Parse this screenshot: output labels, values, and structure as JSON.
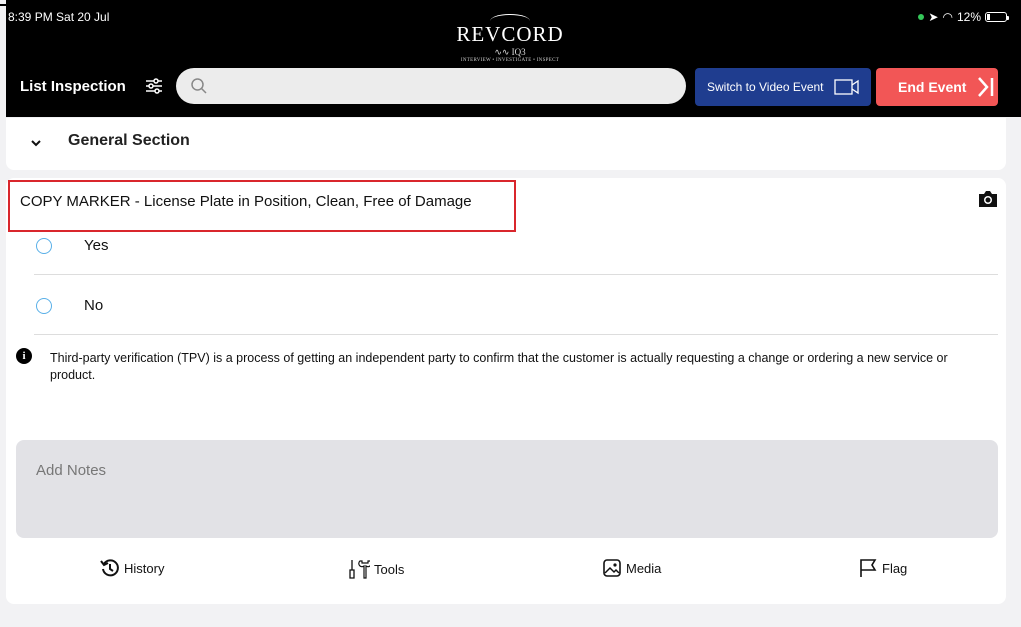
{
  "status_bar": {
    "time": "8:39 PM  Sat 20 Jul",
    "battery": "12%"
  },
  "logo": {
    "text": "REVCORD",
    "sub": "IQ3",
    "tagline": "INTERVIEW • INVESTIGATE • INSPECT"
  },
  "header": {
    "title": "List Inspection",
    "search_placeholder": "",
    "switch_video_label": "Switch to Video Event",
    "end_event_label": "End Event"
  },
  "section": {
    "title": "General Section"
  },
  "question": {
    "text": "COPY MARKER - License Plate in Position, Clean, Free of Damage",
    "options": [
      "Yes",
      "No"
    ],
    "info": "Third-party verification (TPV) is a process of getting an independent party to confirm that the customer is actually requesting a change or ordering a new service or product.",
    "notes_placeholder": "Add Notes"
  },
  "actions": {
    "history": "History",
    "tools": "Tools",
    "media": "Media",
    "flag": "Flag"
  },
  "colors": {
    "video_button": "#1f3d8f",
    "end_button": "#f25656",
    "highlight": "#d9262c",
    "radio": "#5ab0e8"
  }
}
